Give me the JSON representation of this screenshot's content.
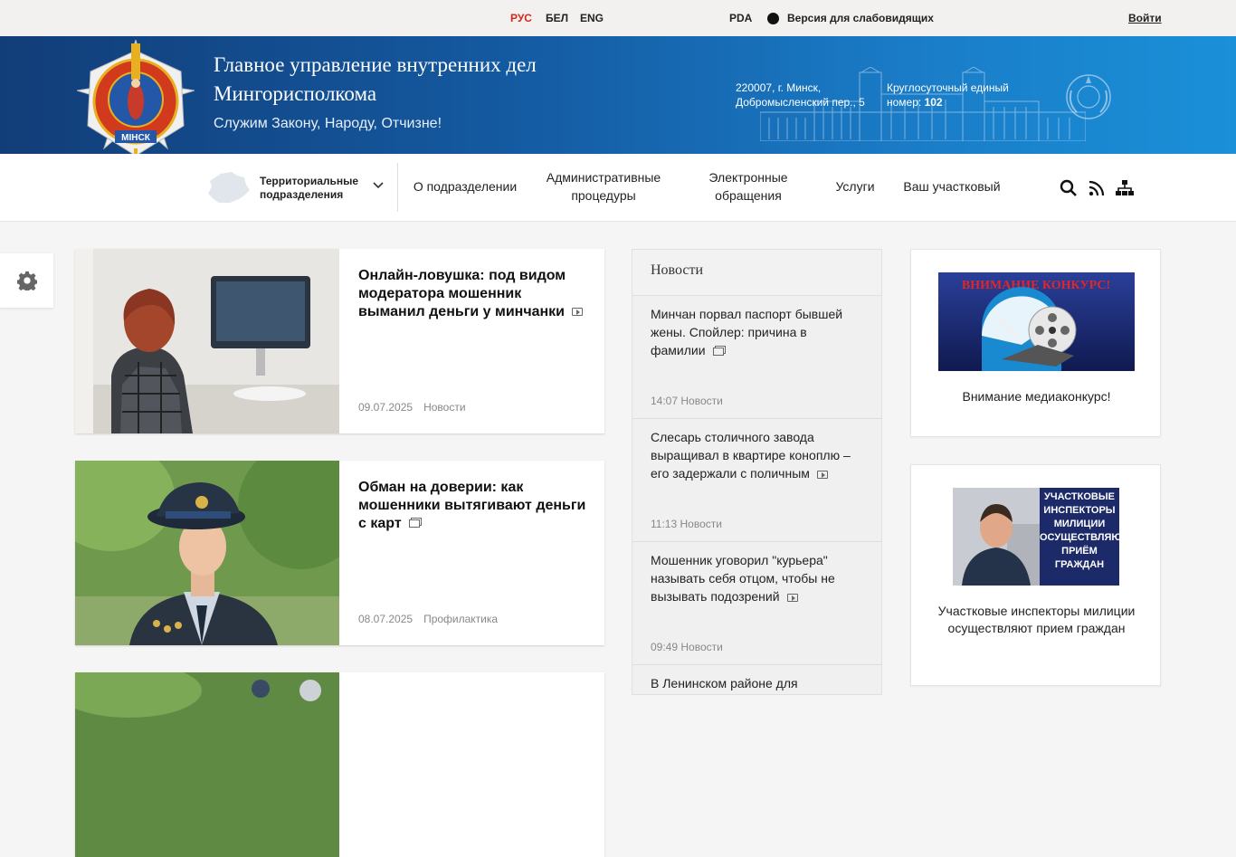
{
  "topbar": {
    "langs": [
      "РУС",
      "БЕЛ",
      "ENG"
    ],
    "pda": "PDA",
    "vision": "Версия для слабовидящих",
    "login": "Войти"
  },
  "banner": {
    "title": "Главное управление внутренних дел Мингорисполкома",
    "slogan": "Служим Закону, Народу, Отчизне!",
    "address": "220007, г. Минск, Добромысленский пер., 5",
    "phone_label": "Круглосуточный единый номер:",
    "phone": "102",
    "emblem_text": "МІНСК"
  },
  "nav": {
    "territorial": "Территориальные подразделения",
    "items": [
      "О подразделении",
      "Административные процедуры",
      "Электронные обращения",
      "Услуги",
      "Ваш участковый"
    ]
  },
  "cards": [
    {
      "title": "Онлайн-ловушка: под видом модератора мошенник выманил деньги у минчанки",
      "date": "09.07.2025",
      "category": "Новости",
      "media": "video"
    },
    {
      "title": "Обман на доверии: как мошенники вытягивают деньги с карт",
      "date": "08.07.2025",
      "category": "Профилактика",
      "media": "gallery"
    }
  ],
  "news": {
    "heading": "Новости",
    "items": [
      {
        "title": "Минчан порвал паспорт бывшей жены. Спойлер: причина в фамилии",
        "time": "14:07",
        "category": "Новости"
      },
      {
        "title": "Слесарь столичного завода выращивал в квартире коноплю – его задержали с поличным",
        "time": "11:13",
        "category": "Новости"
      },
      {
        "title": "Мошенник уговорил \"курьера\" называть себя отцом, чтобы не вызывать подозрений",
        "time": "09:49",
        "category": "Новости"
      },
      {
        "title": "В Ленинском районе для",
        "time": "",
        "category": ""
      }
    ]
  },
  "side": [
    {
      "caption": "Внимание медиаконкурс!",
      "banner_text": "ВНИМАНИЕ КОНКУРС!"
    },
    {
      "caption": "Участковые инспекторы милиции осуществляют прием граждан",
      "banner_lines": [
        "УЧАСТКОВЫЕ",
        "ИНСПЕКТОРЫ",
        "МИЛИЦИИ",
        "ОСУЩЕСТВЛЯЮТ",
        "ПРИЁМ",
        "ГРАЖДАН"
      ]
    }
  ],
  "colors": {
    "accent": "#d8261c",
    "banner_dark": "#123d78",
    "banner_light": "#1a90d8"
  }
}
